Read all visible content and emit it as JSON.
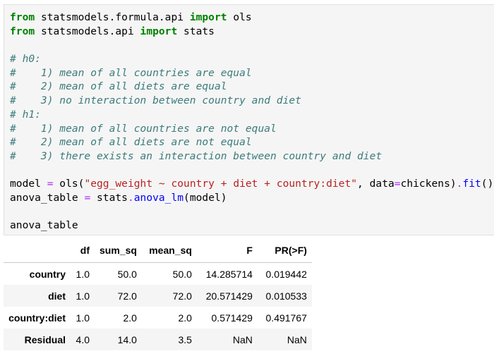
{
  "code_cell": {
    "lines": [
      {
        "tokens": [
          {
            "t": "from",
            "c": "kw"
          },
          {
            "t": " statsmodels.formula.api ",
            "c": "nm"
          },
          {
            "t": "import",
            "c": "kw"
          },
          {
            "t": " ols",
            "c": "nm"
          }
        ]
      },
      {
        "tokens": [
          {
            "t": "from",
            "c": "kw"
          },
          {
            "t": " statsmodels.api ",
            "c": "nm"
          },
          {
            "t": "import",
            "c": "kw"
          },
          {
            "t": " stats",
            "c": "nm"
          }
        ]
      },
      {
        "tokens": []
      },
      {
        "tokens": [
          {
            "t": "# h0:",
            "c": "cm"
          }
        ]
      },
      {
        "tokens": [
          {
            "t": "#    1) mean of all countries are equal",
            "c": "cm"
          }
        ]
      },
      {
        "tokens": [
          {
            "t": "#    2) mean of all diets are equal",
            "c": "cm"
          }
        ]
      },
      {
        "tokens": [
          {
            "t": "#    3) no interaction between country and diet",
            "c": "cm"
          }
        ]
      },
      {
        "tokens": [
          {
            "t": "# h1:",
            "c": "cm"
          }
        ]
      },
      {
        "tokens": [
          {
            "t": "#    1) mean of all countries are not equal",
            "c": "cm"
          }
        ]
      },
      {
        "tokens": [
          {
            "t": "#    2) mean of all diets are not equal",
            "c": "cm"
          }
        ]
      },
      {
        "tokens": [
          {
            "t": "#    3) there exists an interaction between country and diet",
            "c": "cm"
          }
        ]
      },
      {
        "tokens": []
      },
      {
        "tokens": [
          {
            "t": "model ",
            "c": "nm"
          },
          {
            "t": "=",
            "c": "op"
          },
          {
            "t": " ols(",
            "c": "nm"
          },
          {
            "t": "\"egg_weight ~ country + diet + country:diet\"",
            "c": "str"
          },
          {
            "t": ", data",
            "c": "nm"
          },
          {
            "t": "=",
            "c": "op"
          },
          {
            "t": "chickens)",
            "c": "nm"
          },
          {
            "t": ".",
            "c": "op"
          },
          {
            "t": "fit",
            "c": "fn"
          },
          {
            "t": "()",
            "c": "nm"
          }
        ]
      },
      {
        "tokens": [
          {
            "t": "anova_table ",
            "c": "nm"
          },
          {
            "t": "=",
            "c": "op"
          },
          {
            "t": " stats",
            "c": "nm"
          },
          {
            "t": ".",
            "c": "op"
          },
          {
            "t": "anova_lm",
            "c": "fn"
          },
          {
            "t": "(model)",
            "c": "nm"
          }
        ]
      },
      {
        "tokens": []
      },
      {
        "tokens": [
          {
            "t": "anova_table",
            "c": "nm"
          }
        ]
      }
    ]
  },
  "output_table": {
    "columns": [
      "",
      "df",
      "sum_sq",
      "mean_sq",
      "F",
      "PR(>F)"
    ],
    "rows": [
      {
        "index": "country",
        "cells": [
          "1.0",
          "50.0",
          "50.0",
          "14.285714",
          "0.019442"
        ]
      },
      {
        "index": "diet",
        "cells": [
          "1.0",
          "72.0",
          "72.0",
          "20.571429",
          "0.010533"
        ]
      },
      {
        "index": "country:diet",
        "cells": [
          "1.0",
          "2.0",
          "2.0",
          "0.571429",
          "0.491767"
        ]
      },
      {
        "index": "Residual",
        "cells": [
          "4.0",
          "14.0",
          "3.5",
          "NaN",
          "NaN"
        ]
      }
    ]
  },
  "colors": {
    "keyword": "#008000",
    "comment": "#3d7b7b",
    "operator": "#aa22ff",
    "string": "#ba2121",
    "function": "#0000ff",
    "cell_background": "#f5f5f5"
  }
}
